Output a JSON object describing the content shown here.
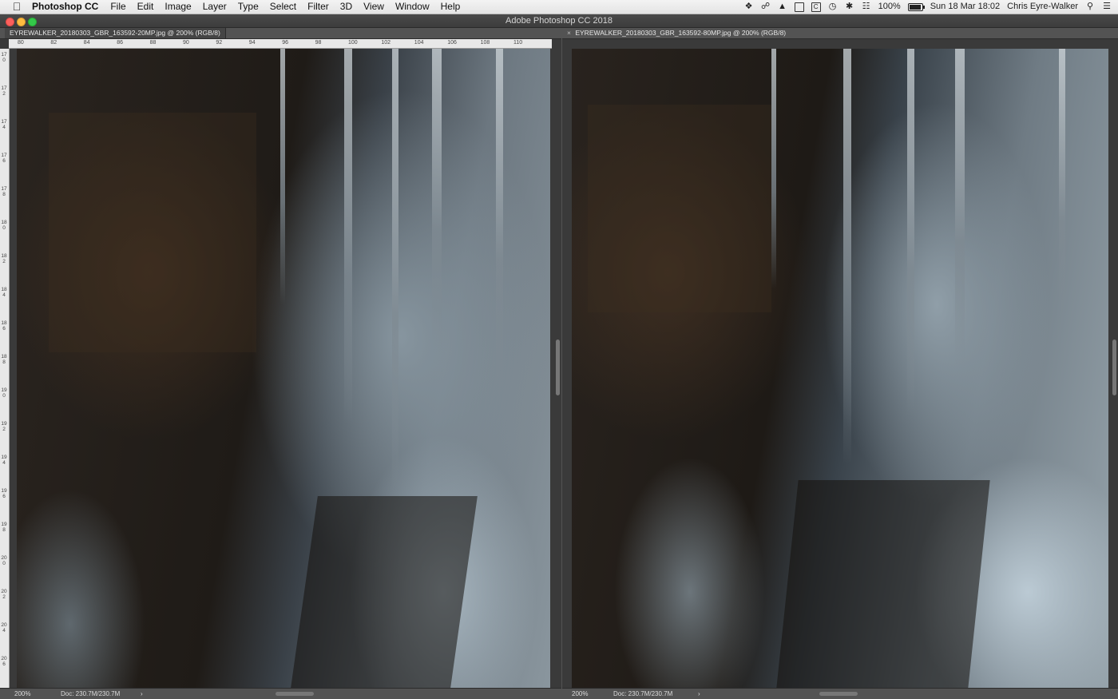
{
  "menubar": {
    "app_name": "Photoshop CC",
    "items": [
      "File",
      "Edit",
      "Image",
      "Layer",
      "Type",
      "Select",
      "Filter",
      "3D",
      "View",
      "Window",
      "Help"
    ],
    "battery": "100%",
    "datetime": "Sun 18 Mar  18:02",
    "user": "Chris Eyre-Walker"
  },
  "window": {
    "title": "Adobe Photoshop CC 2018"
  },
  "left_doc": {
    "tab_title": "EYREWALKER_20180303_GBR_163592-20MP.jpg @ 200% (RGB/8)",
    "ruler_h": [
      "80",
      "82",
      "84",
      "86",
      "88",
      "90",
      "92",
      "94",
      "96",
      "98",
      "100",
      "102",
      "104",
      "106",
      "108",
      "110"
    ],
    "ruler_v": [
      "170",
      "172",
      "174",
      "176",
      "178",
      "180",
      "182",
      "184",
      "186",
      "188",
      "190",
      "192",
      "194",
      "196",
      "198",
      "200",
      "202",
      "204",
      "206"
    ],
    "zoom": "200%",
    "doc_size": "Doc: 230.7M/230.7M",
    "arrow": "›"
  },
  "right_doc": {
    "tab_close": "×",
    "tab_title": "EYREWALKER_20180303_GBR_163592-80MP.jpg @ 200% (RGB/8)",
    "zoom": "200%",
    "doc_size": "Doc: 230.7M/230.7M",
    "arrow": "›"
  }
}
